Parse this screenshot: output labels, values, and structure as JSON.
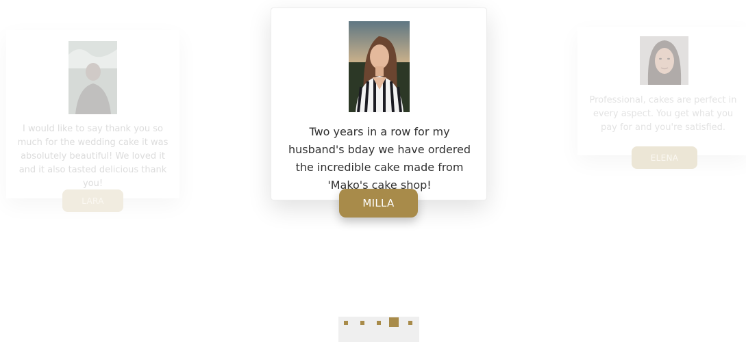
{
  "testimonials": [
    {
      "name": "LARA",
      "quote": "I would like to say thank you so much for the wedding cake it was absolutely beautiful! We loved it and it also tasted delicious thank you!"
    },
    {
      "name": "MILLA",
      "quote": "Two years in a row for my husband's bday we have ordered the incredible cake made from 'Mako's cake shop!"
    },
    {
      "name": "ELENA",
      "quote": "Professional, cakes are perfect in every aspect. You get what you pay for and you're satisfied."
    }
  ],
  "carousel": {
    "active_index": 3,
    "dot_count": 5
  },
  "colors": {
    "accent": "#a88b4a",
    "faded_button": "#f1ece0",
    "text_dark": "#2f2f2f",
    "text_faded": "#dcdcdc"
  }
}
